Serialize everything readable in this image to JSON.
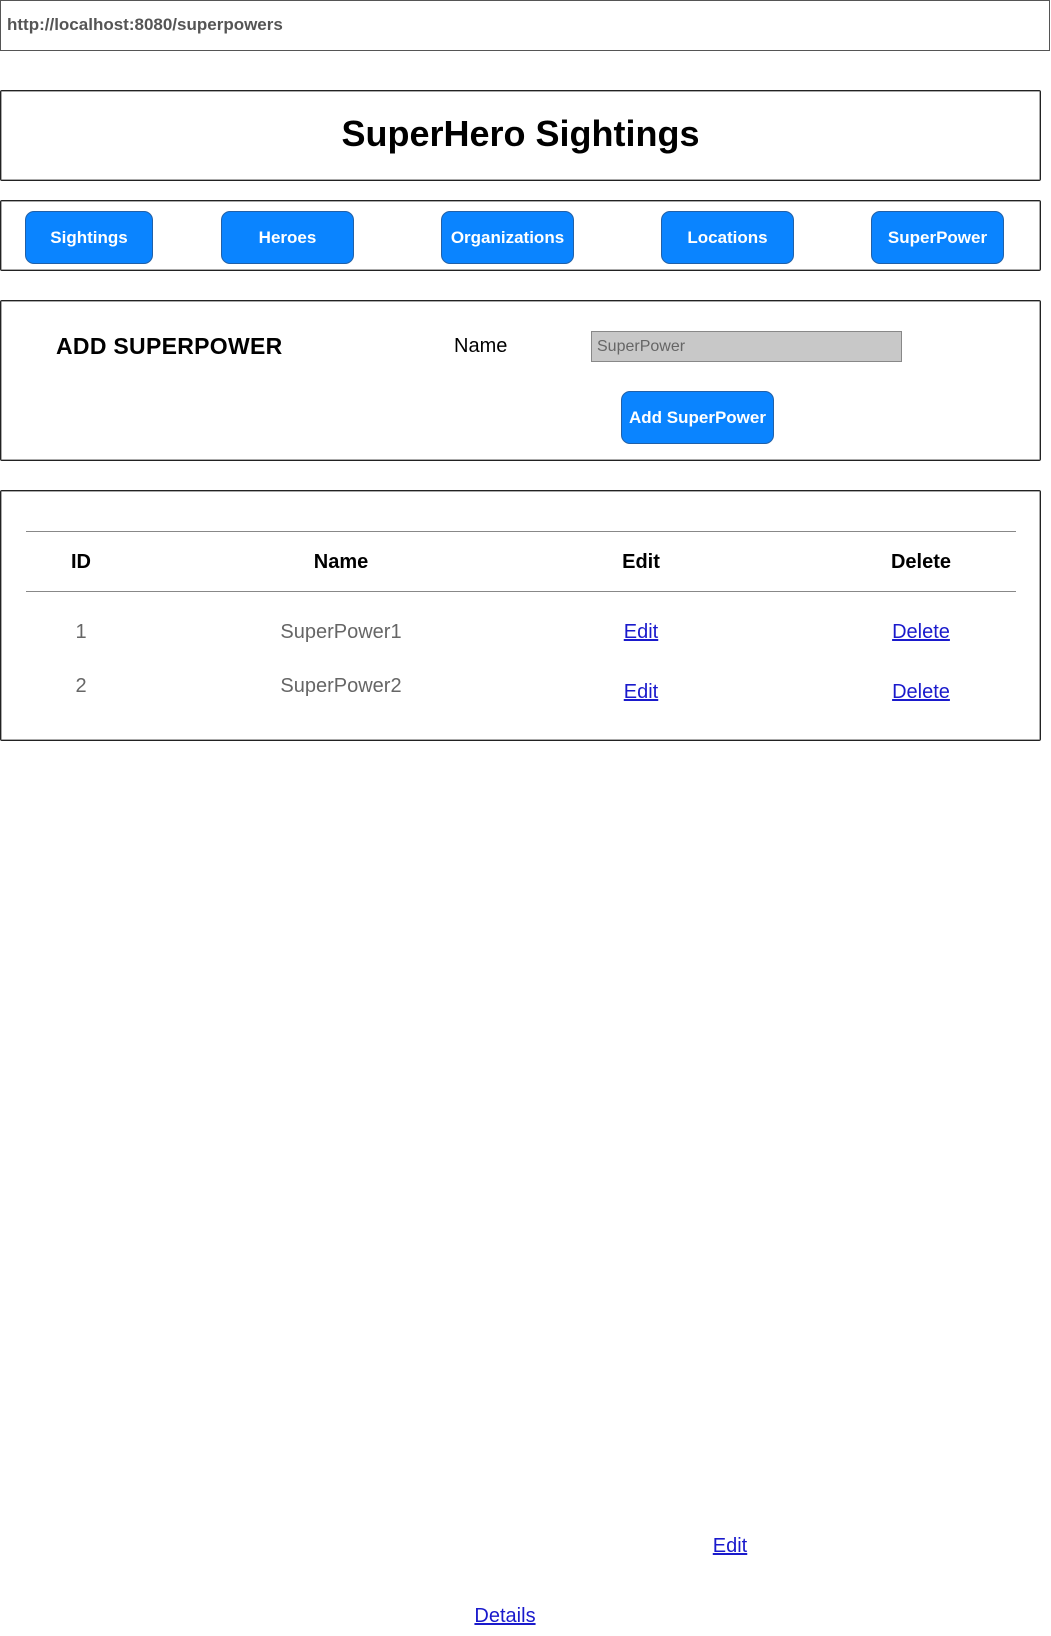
{
  "url_bar": {
    "url": "http://localhost:8080/superpowers"
  },
  "header": {
    "title": "SuperHero Sightings"
  },
  "nav": {
    "items": [
      {
        "label": "Sightings"
      },
      {
        "label": "Heroes"
      },
      {
        "label": "Organizations"
      },
      {
        "label": "Locations"
      },
      {
        "label": "SuperPower"
      }
    ]
  },
  "add_form": {
    "heading": "ADD SUPERPOWER",
    "name_label": "Name",
    "name_placeholder": "SuperPower",
    "submit_label": "Add SuperPower"
  },
  "table": {
    "columns": [
      "ID",
      "Name",
      "Edit",
      "Delete"
    ],
    "rows": [
      {
        "id": "1",
        "name": "SuperPower1",
        "edit": "Edit",
        "delete": "Delete"
      },
      {
        "id": "2",
        "name": "SuperPower2",
        "edit": "Edit",
        "delete": "Delete"
      }
    ]
  },
  "stray_links": {
    "edit": "Edit",
    "details": "Details"
  },
  "colors": {
    "button_blue": "#0a84ff",
    "link_blue": "#1a1acc",
    "input_gray": "#c8c8c8"
  }
}
